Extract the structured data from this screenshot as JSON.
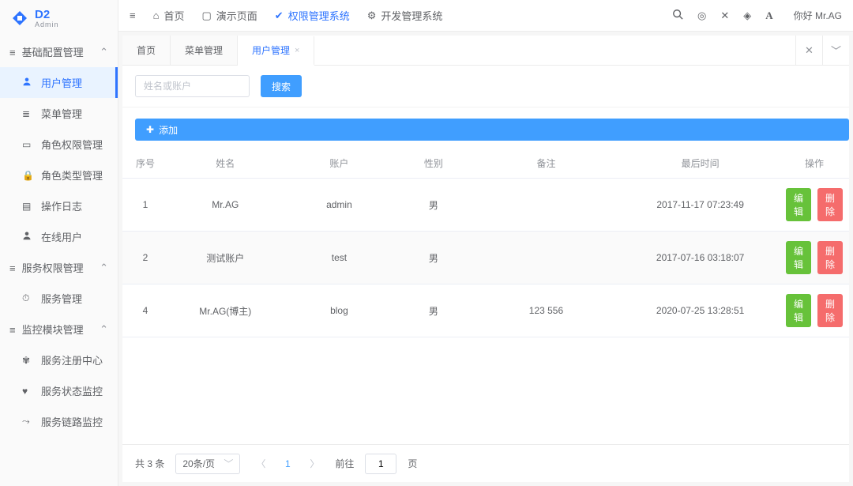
{
  "brand": {
    "name": "D2",
    "sub": "Admin"
  },
  "sidebar": {
    "groups": [
      {
        "label": "基础配置管理",
        "items": [
          {
            "label": "用户管理",
            "icon": "user"
          },
          {
            "label": "菜单管理",
            "icon": "list"
          },
          {
            "label": "角色权限管理",
            "icon": "id"
          },
          {
            "label": "角色类型管理",
            "icon": "lock"
          },
          {
            "label": "操作日志",
            "icon": "file"
          },
          {
            "label": "在线用户",
            "icon": "user"
          }
        ]
      },
      {
        "label": "服务权限管理",
        "items": [
          {
            "label": "服务管理",
            "icon": "gauge"
          }
        ]
      },
      {
        "label": "监控模块管理",
        "items": [
          {
            "label": "服务注册中心",
            "icon": "paw"
          },
          {
            "label": "服务状态监控",
            "icon": "heart"
          },
          {
            "label": "服务链路监控",
            "icon": "chart"
          }
        ]
      }
    ],
    "active_item": "用户管理"
  },
  "topnav": {
    "items": [
      {
        "label": "首页",
        "icon": "home"
      },
      {
        "label": "演示页面",
        "icon": "folder"
      },
      {
        "label": "权限管理系统",
        "icon": "verify",
        "active": true
      },
      {
        "label": "开发管理系统",
        "icon": "gear"
      }
    ],
    "greeting": "你好 Mr.AG"
  },
  "tabs": {
    "items": [
      {
        "label": "首页"
      },
      {
        "label": "菜单管理"
      },
      {
        "label": "用户管理",
        "active": true,
        "closable": true
      }
    ]
  },
  "search": {
    "placeholder": "姓名或账户",
    "button": "搜索"
  },
  "add_button": "添加",
  "table": {
    "columns": [
      "序号",
      "姓名",
      "账户",
      "性别",
      "备注",
      "最后时间",
      "操作"
    ],
    "rows": [
      {
        "seq": "1",
        "name": "Mr.AG",
        "account": "admin",
        "gender": "男",
        "remark": "",
        "last_time": "2017-11-17 07:23:49"
      },
      {
        "seq": "2",
        "name": "测试账户",
        "account": "test",
        "gender": "男",
        "remark": "",
        "last_time": "2017-07-16 03:18:07"
      },
      {
        "seq": "4",
        "name": "Mr.AG(博主)",
        "account": "blog",
        "gender": "男",
        "remark": "123 556",
        "last_time": "2020-07-25 13:28:51"
      }
    ],
    "edit_label": "编辑",
    "delete_label": "删除"
  },
  "pager": {
    "total_text": "共 3 条",
    "per_page_label": "20条/页",
    "current_page": "1",
    "goto_label": "前往",
    "goto_value": "1",
    "page_suffix": "页"
  }
}
